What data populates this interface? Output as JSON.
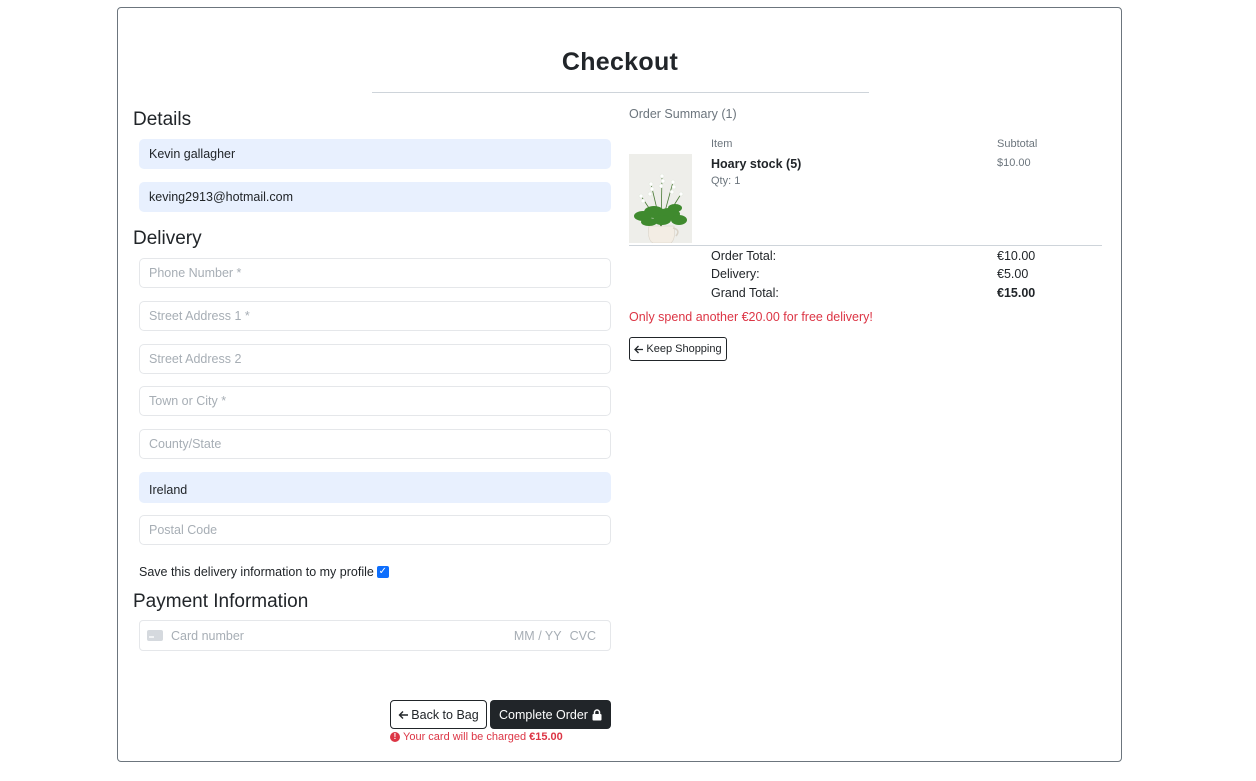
{
  "page": {
    "title": "Checkout"
  },
  "details": {
    "heading": "Details",
    "full_name": "Kevin gallagher",
    "email": "keving2913@hotmail.com"
  },
  "delivery": {
    "heading": "Delivery",
    "phone_placeholder": "Phone Number *",
    "street1_placeholder": "Street Address 1 *",
    "street2_placeholder": "Street Address 2",
    "town_placeholder": "Town or City *",
    "county_placeholder": "County/State",
    "country_value": "Ireland",
    "postcode_placeholder": "Postal Code",
    "save_label": "Save this delivery information to my profile",
    "save_checked": true
  },
  "payment": {
    "heading": "Payment Information",
    "card_placeholder": "Card number",
    "expiry_placeholder": "MM / YY",
    "cvc_placeholder": "CVC"
  },
  "actions": {
    "back_label": "Back to Bag",
    "complete_label": "Complete Order",
    "charge_prefix": "Your card will be charged",
    "charge_amount": "€15.00"
  },
  "summary": {
    "heading": "Order Summary (1)",
    "col_item": "Item",
    "col_subtotal": "Subtotal",
    "item": {
      "name": "Hoary stock (5)",
      "qty": "Qty: 1",
      "subtotal": "$10.00"
    },
    "order_total_label": "Order Total:",
    "order_total": "€10.00",
    "delivery_label": "Delivery:",
    "delivery_cost": "€5.00",
    "grand_total_label": "Grand Total:",
    "grand_total": "€15.00",
    "free_delivery_note": "Only spend another €20.00 for free delivery!",
    "keep_shopping_label": "Keep Shopping"
  },
  "colors": {
    "primary_dark": "#212529",
    "autofill_bg": "#e8f0fe",
    "danger": "#dc3545",
    "checkbox": "#0d6efd"
  }
}
